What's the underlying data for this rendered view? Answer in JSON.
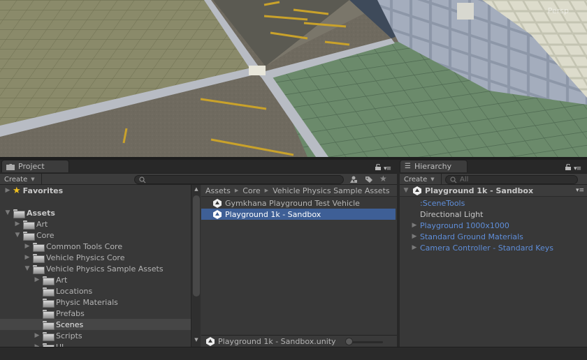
{
  "scene": {
    "view_label": "Persp"
  },
  "project": {
    "tab_label": "Project",
    "create_label": "Create",
    "search_placeholder": "",
    "favorites_label": "Favorites",
    "tree": [
      {
        "label": "Assets",
        "depth": 0,
        "expanded": true,
        "has_children": true,
        "bold": true
      },
      {
        "label": "Art",
        "depth": 1,
        "expanded": false,
        "has_children": true
      },
      {
        "label": "Core",
        "depth": 1,
        "expanded": true,
        "has_children": true
      },
      {
        "label": "Common Tools Core",
        "depth": 2,
        "expanded": false,
        "has_children": true
      },
      {
        "label": "Vehicle Physics Core",
        "depth": 2,
        "expanded": false,
        "has_children": true
      },
      {
        "label": "Vehicle Physics Sample Assets",
        "depth": 2,
        "expanded": true,
        "has_children": true
      },
      {
        "label": "Art",
        "depth": 3,
        "expanded": false,
        "has_children": true
      },
      {
        "label": "Locations",
        "depth": 3,
        "expanded": false,
        "has_children": false
      },
      {
        "label": "Physic Materials",
        "depth": 3,
        "expanded": false,
        "has_children": false
      },
      {
        "label": "Prefabs",
        "depth": 3,
        "expanded": false,
        "has_children": false
      },
      {
        "label": "Scenes",
        "depth": 3,
        "expanded": false,
        "has_children": false,
        "selected": true
      },
      {
        "label": "Scripts",
        "depth": 3,
        "expanded": false,
        "has_children": true
      },
      {
        "label": "UI",
        "depth": 3,
        "expanded": false,
        "has_children": true
      }
    ],
    "breadcrumb": [
      "Assets",
      "Core",
      "Vehicle Physics Sample Assets"
    ],
    "files": [
      {
        "label": "Gymkhana Playground Test Vehicle",
        "icon": "unity-scene-icon",
        "selected": false
      },
      {
        "label": "Playground 1k - Sandbox",
        "icon": "unity-scene-icon",
        "selected": true
      }
    ],
    "selected_path": "Playground 1k - Sandbox.unity",
    "icon_size_fraction": 0.0
  },
  "hierarchy": {
    "tab_label": "Hierarchy",
    "create_label": "Create",
    "search_placeholder": "All",
    "scene_name": "Playground 1k - Sandbox",
    "items": [
      {
        "label": ":SceneTools",
        "has_children": false,
        "prefab": true
      },
      {
        "label": "Directional Light",
        "has_children": false,
        "prefab": false
      },
      {
        "label": "Playground 1000x1000",
        "has_children": true,
        "prefab": true
      },
      {
        "label": "Standard Ground Materials",
        "has_children": true,
        "prefab": true
      },
      {
        "label": "Camera Controller - Standard Keys",
        "has_children": true,
        "prefab": true
      }
    ]
  },
  "colors": {
    "selection_blue": "#3e5f96",
    "prefab_blue": "#5f8ed9",
    "panel_bg": "#383838"
  }
}
